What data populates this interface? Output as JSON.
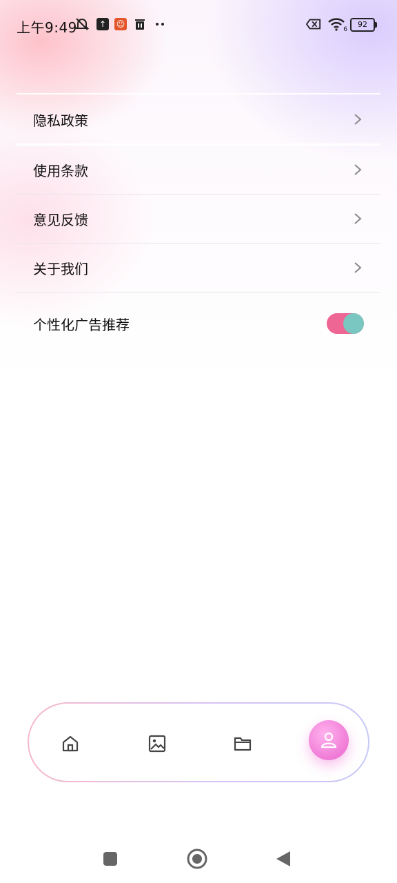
{
  "status_bar": {
    "time": "上午9:49",
    "battery_level": "92",
    "icons": [
      "mute-bell-icon",
      "upload-icon",
      "app-notification-icon",
      "trash-icon",
      "more-dots-icon",
      "sim-off-icon",
      "wifi-icon",
      "battery-icon"
    ],
    "wifi_badge": "6"
  },
  "menu": {
    "items": [
      {
        "label": "隐私政策"
      },
      {
        "label": "使用条款"
      },
      {
        "label": "意见反馈"
      },
      {
        "label": "关于我们"
      }
    ],
    "toggle": {
      "label": "个性化广告推荐",
      "enabled": true,
      "on_color": "#ee6694",
      "knob_color": "#79c7c0"
    }
  },
  "bottom_nav": {
    "items": [
      "home-icon",
      "gallery-icon",
      "folder-icon",
      "profile-icon"
    ],
    "active": "profile-icon",
    "accent": "#f07bd6"
  },
  "system_nav": [
    "recent-apps-icon",
    "home-circle-icon",
    "back-triangle-icon"
  ]
}
